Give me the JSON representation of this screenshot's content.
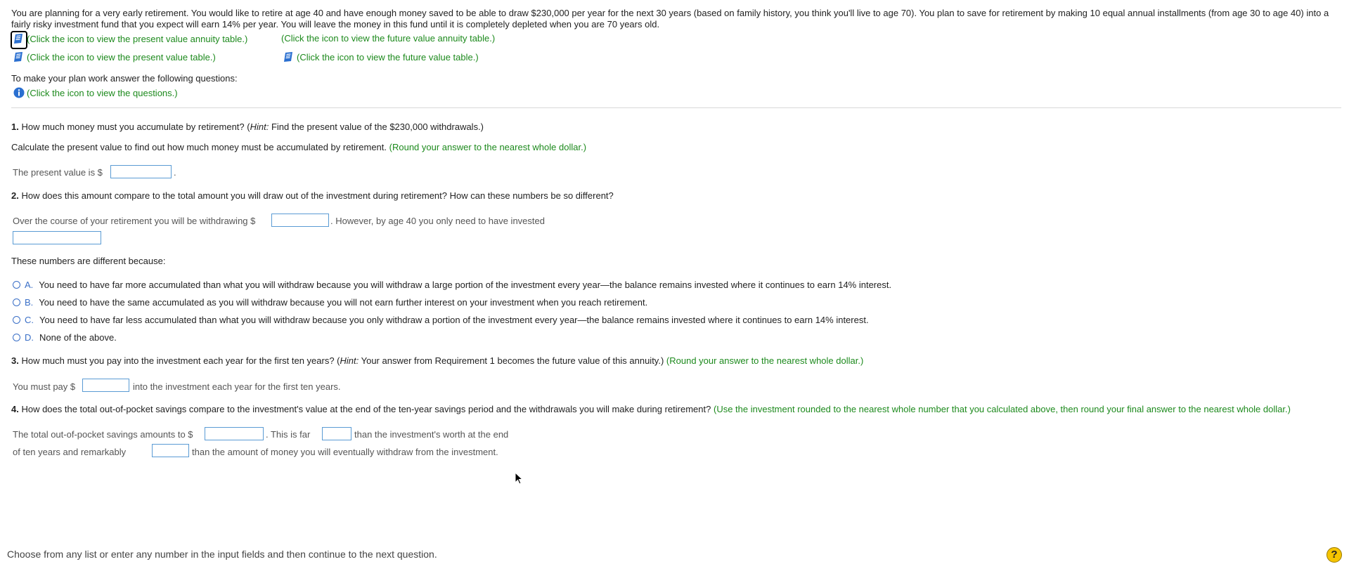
{
  "intro": "You are planning for a very early retirement. You would like to retire at age 40 and have enough money saved to be able to draw $230,000 per year for the next 30 years (based on family history, you think you'll live to age 70). You plan to save for retirement by making 10 equal annual installments (from age 30 to age 40) into a fairly risky investment fund that you expect will earn 14% per year. You will leave the money in this fund until it is completely depleted when you are 70 years old.",
  "links": {
    "pv_annuity": "(Click the icon to view the present value annuity table.)",
    "fv_annuity": "(Click the icon to view the future value annuity table.)",
    "pv_table": "(Click the icon to view the present value table.)",
    "fv_table": "(Click the icon to view the future value table.)",
    "questions": "(Click the icon to view the questions.)"
  },
  "plan_prompt": "To make your plan work answer the following questions:",
  "q1": {
    "num": "1.",
    "text_a": " How much money must you accumulate by retirement? (",
    "hint": "Hint:",
    "text_b": " Find the present value of the $230,000 withdrawals.)",
    "calc": "Calculate the present value to find out how much money must be accumulated by retirement.",
    "round": "(Round your answer to the nearest whole dollar.)",
    "answer_label": "The present value is $",
    "answer_value": ""
  },
  "q2": {
    "num": "2.",
    "text": " How does this amount compare to the total amount you will draw out of the investment during retirement? How can these numbers be so different?",
    "line_a": "Over the course of your retirement you will be withdrawing $",
    "line_b": ". However, by age 40 you only need to have invested",
    "because": "These numbers are different because:",
    "options": [
      {
        "letter": "A.",
        "text": "You need to have far more accumulated than what you will withdraw because you will withdraw a large portion of the investment every year—the balance remains invested where it continues to earn 14% interest."
      },
      {
        "letter": "B.",
        "text": "You need to have the same accumulated as you will withdraw because you will not earn further interest on your investment when you reach retirement."
      },
      {
        "letter": "C.",
        "text": "You need to have far less accumulated than what you will withdraw because you only withdraw a portion of the investment every year—the balance remains invested where it continues to earn 14% interest."
      },
      {
        "letter": "D.",
        "text": "None of the above."
      }
    ]
  },
  "q3": {
    "num": "3.",
    "text_a": " How much must you pay into the investment each year for the first ten years? (",
    "hint": "Hint:",
    "text_b": " Your answer from Requirement 1 becomes the future value of this annuity.)",
    "round": "(Round your answer to the nearest whole dollar.)",
    "label_a": "You must pay $",
    "label_b": "into the investment each year for the first ten years."
  },
  "q4": {
    "num": "4.",
    "text": " How does the total out-of-pocket savings compare to the investment's value at the end of the ten-year savings period and the withdrawals you will make during retirement?",
    "instruction": "(Use the investment rounded to the nearest whole number that you calculated above, then round your final answer to the nearest whole dollar.)",
    "line1_a": "The total out-of-pocket savings amounts to $",
    "line1_b": ". This is far",
    "line1_c": "than the investment's worth at the end",
    "line2_a": "of ten years and remarkably",
    "line2_b": "than the amount of money you will eventually withdraw from the investment."
  },
  "footer": "Choose from any list or enter any number in the input fields and then continue to the next question.",
  "help": "?",
  "colors": {
    "green": "#1d8a1d",
    "input_border": "#5a9bd4",
    "radio": "#3a6fc7",
    "icon_blue": "#2a6fd0",
    "help_bg": "#f5c400"
  }
}
